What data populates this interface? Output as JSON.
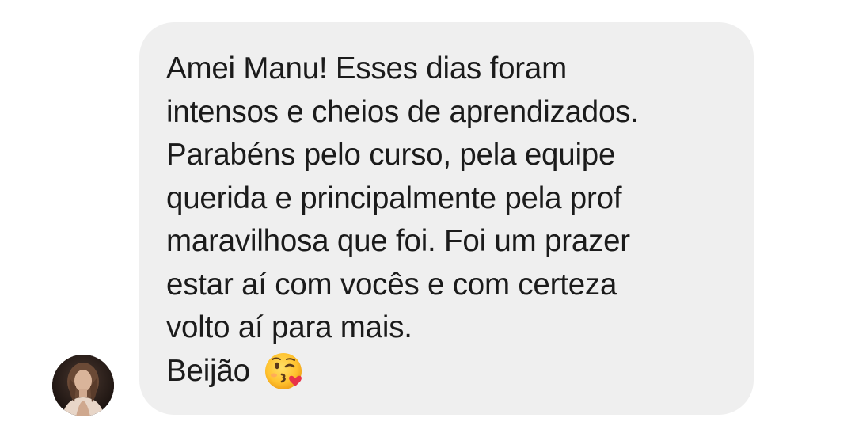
{
  "message": {
    "lines": [
      "Amei Manu! Esses dias foram",
      "intensos e cheios de aprendizados.",
      "Parabéns pelo curso, pela equipe",
      "querida e principalmente pela prof",
      "maravilhosa que foi. Foi um prazer",
      "estar aí com vocês e com certeza",
      "volto aí para mais."
    ],
    "sign_off": "Beijão",
    "emoji": "face-blowing-a-kiss"
  },
  "sender": {
    "avatar_icon": "profile-photo"
  },
  "colors": {
    "bubble": "#efefef",
    "text": "#1b1b1b",
    "background": "#ffffff"
  }
}
